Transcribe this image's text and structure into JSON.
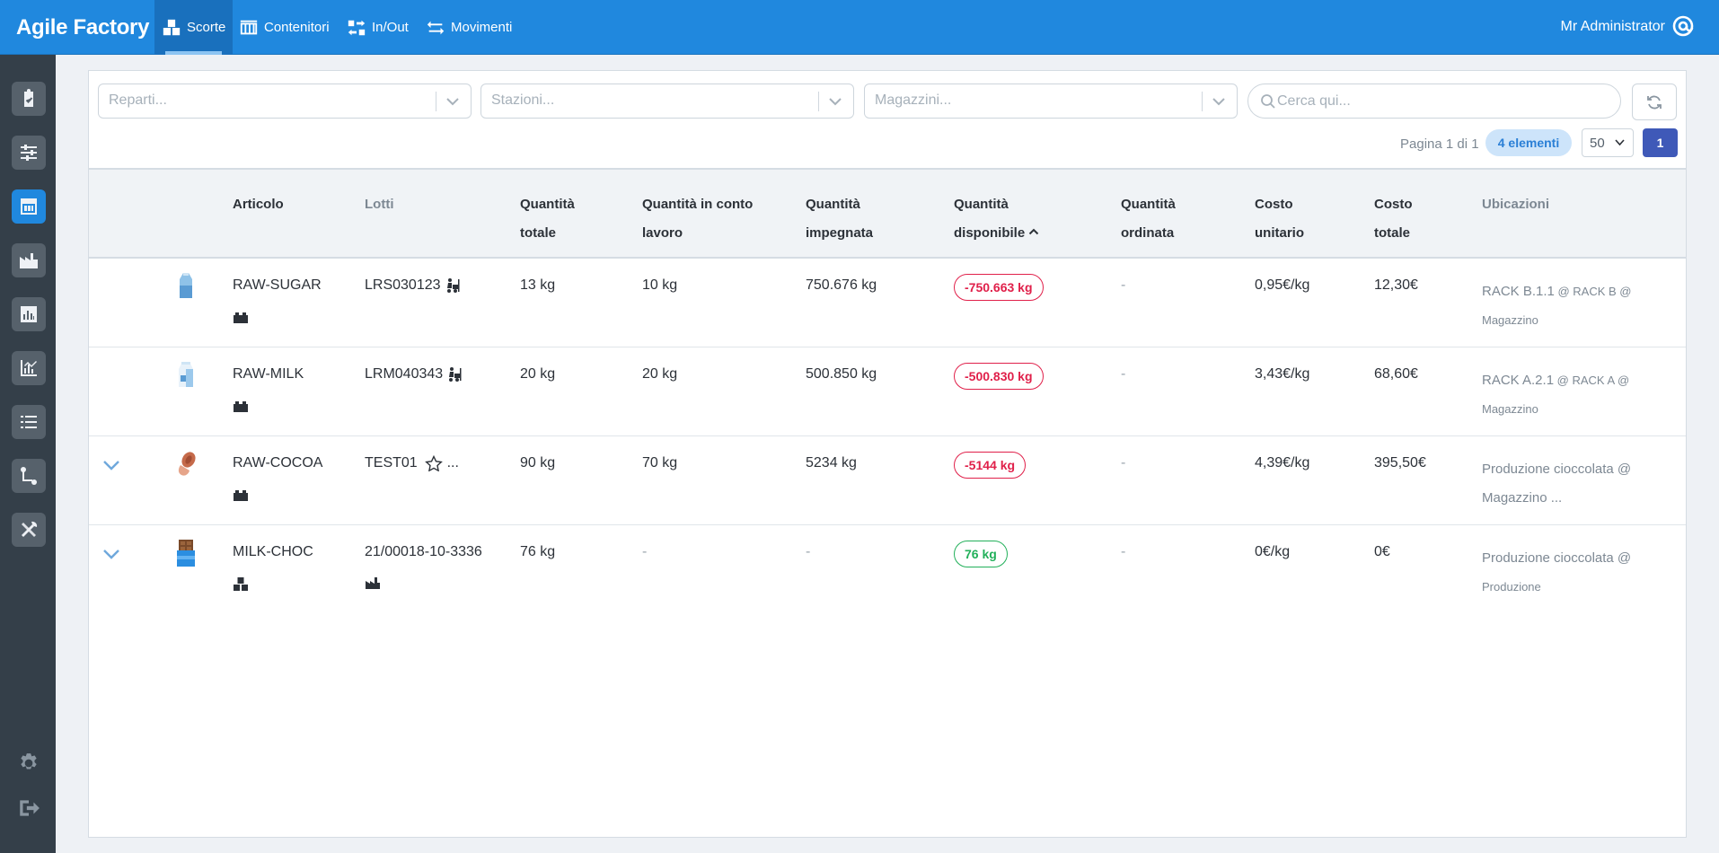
{
  "app": {
    "title": "Agile Factory",
    "user": "Mr Administrator"
  },
  "nav": [
    {
      "label": "Scorte",
      "active": true
    },
    {
      "label": "Contenitori",
      "active": false
    },
    {
      "label": "In/Out",
      "active": false
    },
    {
      "label": "Movimenti",
      "active": false
    }
  ],
  "filters": {
    "reparti": "Reparti...",
    "stazioni": "Stazioni...",
    "magazzini": "Magazzini...",
    "search_placeholder": "Cerca qui..."
  },
  "pager": {
    "text": "Pagina 1 di 1",
    "count": "4 elementi",
    "per_page": "50",
    "current": "1"
  },
  "columns": {
    "articolo": "Articolo",
    "lotti": "Lotti",
    "qta_totale_1": "Quantità",
    "qta_totale_2": "totale",
    "qta_conto_1": "Quantità in conto",
    "qta_conto_2": "lavoro",
    "qta_impegnata_1": "Quantità",
    "qta_impegnata_2": "impegnata",
    "qta_disponibile_1": "Quantità",
    "qta_disponibile_2": "disponibile",
    "qta_ordinata_1": "Quantità",
    "qta_ordinata_2": "ordinata",
    "costo_unitario_1": "Costo",
    "costo_unitario_2": "unitario",
    "costo_totale_1": "Costo",
    "costo_totale_2": "totale",
    "ubicazioni": "Ubicazioni"
  },
  "rows": [
    {
      "article": "RAW-SUGAR",
      "lot": "LRS030123",
      "totale": "13 kg",
      "conto_lavoro": "10 kg",
      "impegnata": "750.676 kg",
      "disponibile": "-750.663 kg",
      "ordinata": "-",
      "costo_unitario": "0,95€/kg",
      "costo_totale": "12,30€",
      "loc_main": "RACK B.1.1",
      "loc_small": " @ RACK B @",
      "loc_line2": "Magazzino"
    },
    {
      "article": "RAW-MILK",
      "lot": "LRM040343",
      "totale": "20 kg",
      "conto_lavoro": "20 kg",
      "impegnata": "500.850 kg",
      "disponibile": "-500.830 kg",
      "ordinata": "-",
      "costo_unitario": "3,43€/kg",
      "costo_totale": "68,60€",
      "loc_main": "RACK A.2.1",
      "loc_small": " @ RACK A @",
      "loc_line2": "Magazzino"
    },
    {
      "article": "RAW-COCOA",
      "lot": "TEST01",
      "lot_more": "...",
      "totale": "90 kg",
      "conto_lavoro": "70 kg",
      "impegnata": "5234 kg",
      "disponibile": "-5144 kg",
      "ordinata": "-",
      "costo_unitario": "4,39€/kg",
      "costo_totale": "395,50€",
      "loc_main": "Produzione cioccolata @",
      "loc_small": "",
      "loc_line2": "Magazzino ..."
    },
    {
      "article": "MILK-CHOC",
      "lot": "21/00018-10-3336",
      "totale": "76 kg",
      "conto_lavoro": "-",
      "impegnata": "-",
      "disponibile": "76 kg",
      "ordinata": "-",
      "costo_unitario": "0€/kg",
      "costo_totale": "0€",
      "loc_main": "Produzione cioccolata @",
      "loc_small": "",
      "loc_line2": "Produzione"
    }
  ],
  "colors": {
    "topbar": "#2088de",
    "sidebar": "#343f49",
    "accent": "#2088de",
    "negative": "#e0204a",
    "positive": "#22b05a",
    "page_button": "#3f59b8"
  },
  "icons": {
    "sidebar": [
      "clipboard-check-icon",
      "sliders-icon",
      "warehouse-icon",
      "factory-icon",
      "bar-chart-icon",
      "line-chart-icon",
      "list-icon",
      "route-icon",
      "tools-icon",
      "gear-icon",
      "logout-icon"
    ]
  }
}
